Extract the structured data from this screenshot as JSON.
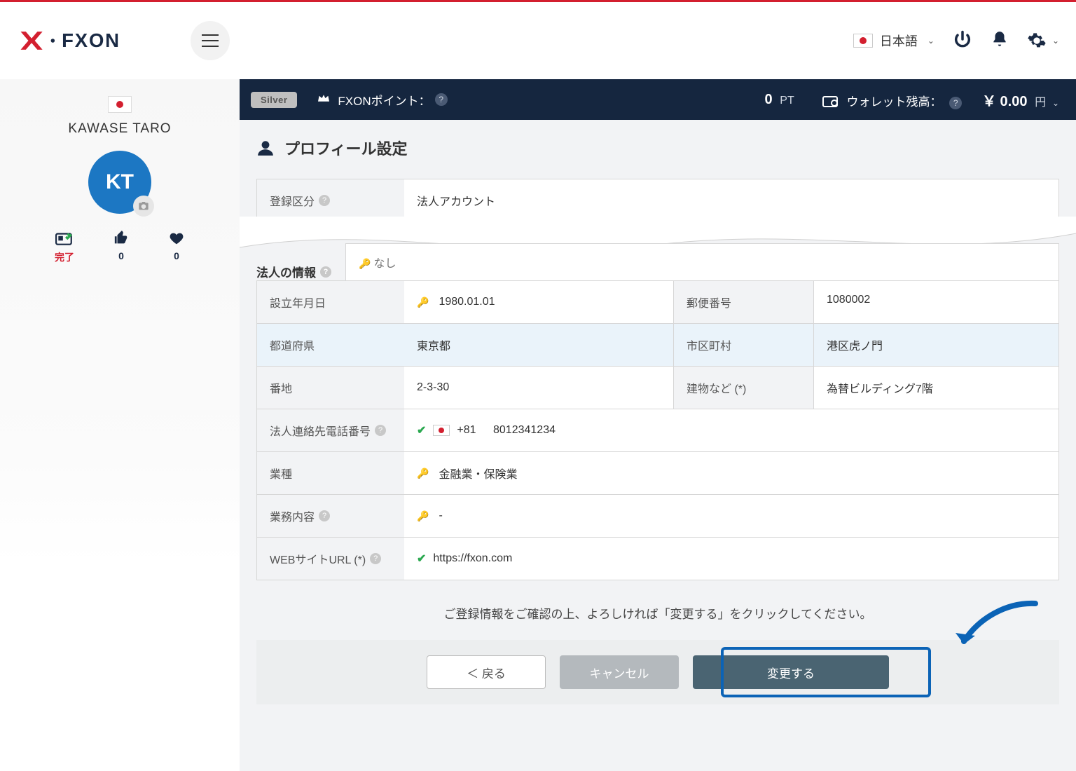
{
  "header": {
    "language_label": "日本語"
  },
  "ptbar": {
    "tier": "Silver",
    "points_label": "FXONポイント：",
    "points_value": "0",
    "points_unit": "PT",
    "wallet_label": "ウォレット残高：",
    "currency": "￥",
    "balance": "0.00",
    "balance_unit": "円"
  },
  "sidebar": {
    "username": "KAWASE TARO",
    "avatar_initials": "KT",
    "stats": [
      {
        "label": "完了",
        "value": ""
      },
      {
        "label": "",
        "value": "0"
      },
      {
        "label": "",
        "value": "0"
      }
    ]
  },
  "page": {
    "title": "プロフィール設定",
    "section2_title": "法人の情報",
    "confirm_text": "ご登録情報をご確認の上、よろしければ「変更する」をクリックしてください。",
    "back": "＜ 戻る",
    "cancel": "キャンセル",
    "submit": "変更する"
  },
  "fields": {
    "reg_type_label": "登録区分",
    "reg_type_value": "法人アカウント",
    "none_value": "なし",
    "est_date_label": "設立年月日",
    "est_date_value": "1980.01.01",
    "postal_label": "郵便番号",
    "postal_value": "1080002",
    "pref_label": "都道府県",
    "pref_value": "東京都",
    "city_label": "市区町村",
    "city_value": "港区虎ノ門",
    "street_label": "番地",
    "street_value": "2-3-30",
    "bldg_label": "建物など (*)",
    "bldg_value": "為替ビルディング7階",
    "phone_label": "法人連絡先電話番号",
    "phone_cc": "+81",
    "phone_num": "8012341234",
    "industry_label": "業種",
    "industry_value": "金融業・保険業",
    "bizdesc_label": "業務内容",
    "bizdesc_value": "-",
    "url_label": "WEBサイトURL (*)",
    "url_value": "https://fxon.com"
  }
}
